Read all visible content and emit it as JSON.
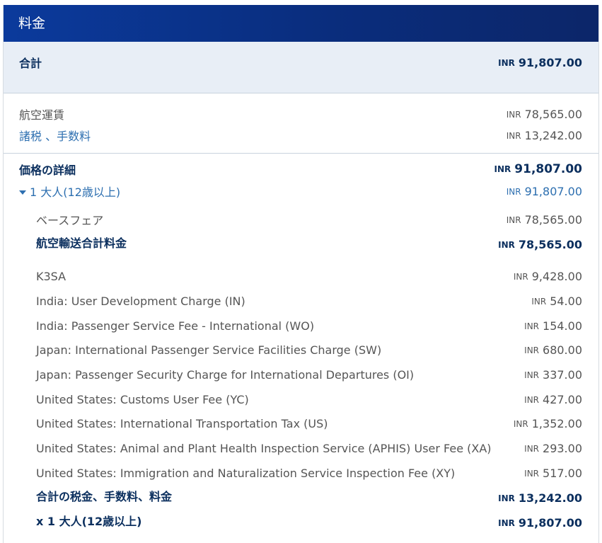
{
  "header": {
    "title": "料金"
  },
  "total": {
    "label": "合計",
    "currency": "INR",
    "amount": "91,807.00"
  },
  "summary": {
    "fare": {
      "label": "航空運賃",
      "currency": "INR",
      "amount": "78,565.00"
    },
    "taxes": {
      "label": "諸税 、手数料",
      "currency": "INR",
      "amount": "13,242.00"
    }
  },
  "details": {
    "title": "価格の詳細",
    "currency": "INR",
    "amount": "91,807.00",
    "passenger": {
      "label": "1 大人(12歳以上)",
      "currency": "INR",
      "amount": "91,807.00"
    },
    "base_fare": {
      "label": "ベースフェア",
      "currency": "INR",
      "amount": "78,565.00"
    },
    "air_total": {
      "label": "航空輸送合計料金",
      "currency": "INR",
      "amount": "78,565.00"
    },
    "taxes": [
      {
        "label": "K3SA",
        "currency": "INR",
        "amount": "9,428.00"
      },
      {
        "label": "India: User Development Charge (IN)",
        "currency": "INR",
        "amount": "54.00"
      },
      {
        "label": "India: Passenger Service Fee - International (WO)",
        "currency": "INR",
        "amount": "154.00"
      },
      {
        "label": "Japan: International Passenger Service Facilities Charge (SW)",
        "currency": "INR",
        "amount": "680.00"
      },
      {
        "label": "Japan: Passenger Security Charge for International Departures (OI)",
        "currency": "INR",
        "amount": "337.00"
      },
      {
        "label": "United States: Customs User Fee (YC)",
        "currency": "INR",
        "amount": "427.00"
      },
      {
        "label": "United States: International Transportation Tax (US)",
        "currency": "INR",
        "amount": "1,352.00"
      },
      {
        "label": "United States: Animal and Plant Health Inspection Service (APHIS) User Fee (XA)",
        "currency": "INR",
        "amount": "293.00"
      },
      {
        "label": "United States: Immigration and Naturalization Service Inspection Fee (XY)",
        "currency": "INR",
        "amount": "517.00"
      }
    ],
    "taxes_total": {
      "label": "合計の税金、手数料、料金",
      "currency": "INR",
      "amount": "13,242.00"
    },
    "multiplier": {
      "label": "x 1 大人(12歳以上)",
      "currency": "INR",
      "amount": "91,807.00"
    }
  }
}
